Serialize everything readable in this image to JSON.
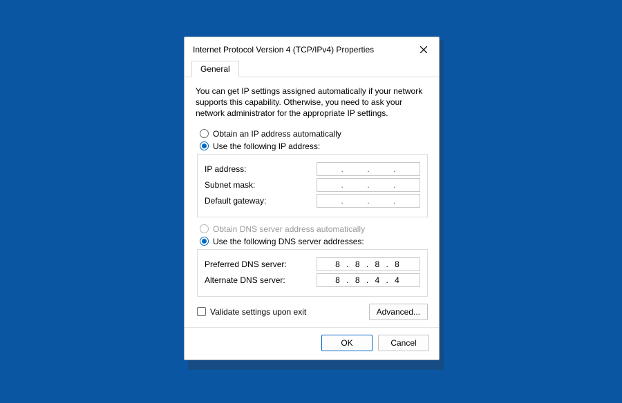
{
  "dialog": {
    "title": "Internet Protocol Version 4 (TCP/IPv4) Properties",
    "tab": "General",
    "description": "You can get IP settings assigned automatically if your network supports this capability. Otherwise, you need to ask your network administrator for the appropriate IP settings.",
    "ip_section": {
      "obtain_auto": "Obtain an IP address automatically",
      "use_following": "Use the following IP address:",
      "selected": "use_following",
      "fields": {
        "ip_address_label": "IP address:",
        "ip_address_value": "",
        "subnet_label": "Subnet mask:",
        "subnet_value": "",
        "gateway_label": "Default gateway:",
        "gateway_value": ""
      }
    },
    "dns_section": {
      "obtain_auto": "Obtain DNS server address automatically",
      "obtain_auto_enabled": false,
      "use_following": "Use the following DNS server addresses:",
      "selected": "use_following",
      "fields": {
        "preferred_label": "Preferred DNS server:",
        "preferred_value": "8 . 8 . 8 . 8",
        "alternate_label": "Alternate DNS server:",
        "alternate_value": "8 . 8 . 4 . 4"
      }
    },
    "validate_label": "Validate settings upon exit",
    "validate_checked": false,
    "advanced_label": "Advanced...",
    "ok_label": "OK",
    "cancel_label": "Cancel"
  }
}
